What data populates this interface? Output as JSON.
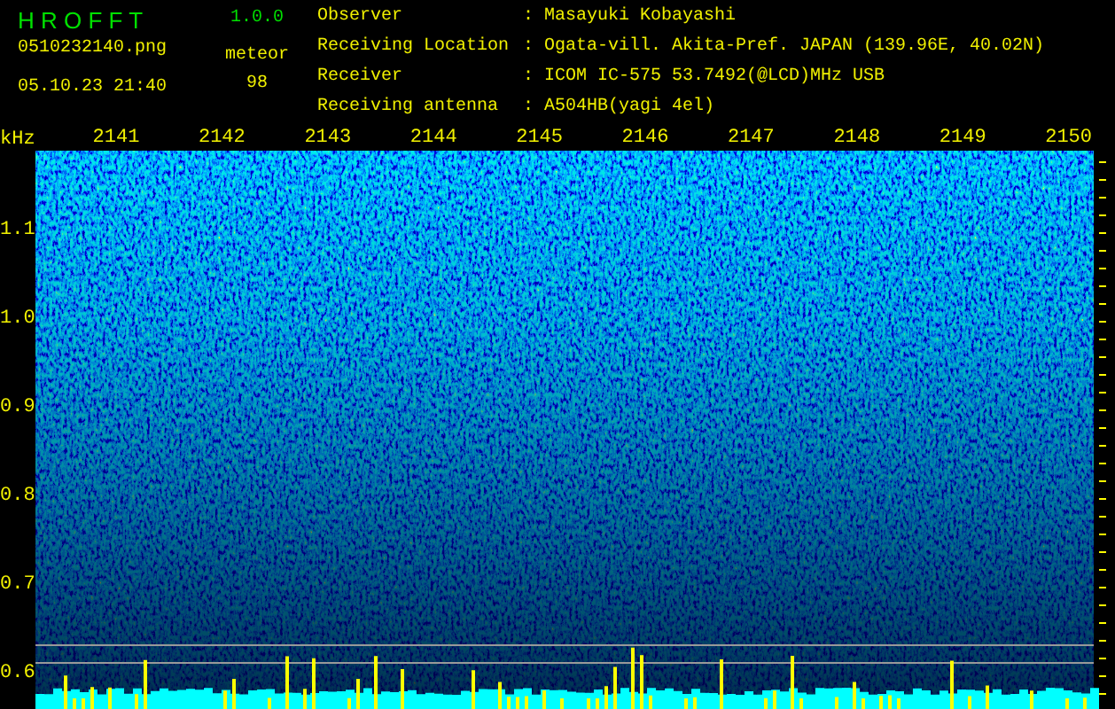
{
  "app": {
    "title": "H R O F F T",
    "version": "1.0.0",
    "file": "0510232140.png",
    "datetime": "05.10.23 21:40",
    "counter_label": "meteor",
    "counter_value": "98"
  },
  "station": [
    {
      "label": "Observer",
      "colon": ":",
      "value": "Masayuki Kobayashi"
    },
    {
      "label": "Receiving Location",
      "colon": ":",
      "value": "Ogata-vill. Akita-Pref. JAPAN (139.96E, 40.02N)"
    },
    {
      "label": "Receiver",
      "colon": ":",
      "value": "ICOM IC-575 53.7492(@LCD)MHz USB"
    },
    {
      "label": "Receiving antenna",
      "colon": ":",
      "value": "A504HB(yagi 4el)"
    }
  ],
  "spectrogram": {
    "frequency_unit": "kHz",
    "frequency_labels": [
      "1.1",
      "1.0",
      "0.9",
      "0.8",
      "0.7",
      "0.6"
    ],
    "time_labels": [
      "2141",
      "2142",
      "2143",
      "2144",
      "2145",
      "2146",
      "2147",
      "2148",
      "2149",
      "2150"
    ]
  }
}
